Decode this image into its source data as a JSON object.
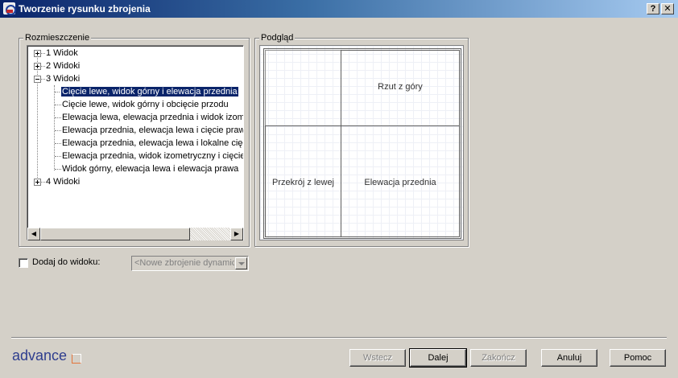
{
  "window": {
    "title": "Tworzenie rysunku zbrojenia",
    "help_button": "?",
    "close_button": "✕"
  },
  "layout_group": {
    "label": "Rozmieszczenie",
    "tree": {
      "nodes": [
        {
          "label": "1 Widok",
          "expanded": false
        },
        {
          "label": "2 Widoki",
          "expanded": false
        },
        {
          "label": "3 Widoki",
          "expanded": true
        },
        {
          "label": "4 Widoki",
          "expanded": false
        }
      ],
      "children": [
        "Cięcie lewe, widok górny i elewacja przednia",
        "Cięcie lewe, widok górny i obcięcie przodu",
        "Elewacja lewa, elewacja przednia i widok izometryczny",
        "Elewacja przednia, elewacja lewa i cięcie prawe",
        "Elewacja przednia, elewacja lewa i lokalne cięcie",
        "Elewacja przednia, widok izometryczny i cięcie lewe",
        "Widok górny, elewacja lewa i elewacja prawa"
      ],
      "selected_child": 0
    }
  },
  "preview_group": {
    "label": "Podgląd",
    "views": {
      "top": "Rzut z góry",
      "left": "Przekrój z lewej",
      "front": "Elewacja przednia"
    }
  },
  "add_to_view": {
    "label": "Dodaj do widoku:",
    "checked": false,
    "combo_value": "<Nowe zbrojenie dynamiczne>"
  },
  "logo": "advance",
  "buttons": {
    "back": "Wstecz",
    "next": "Dalej",
    "finish": "Zakończ",
    "cancel": "Anuluj",
    "help": "Pomoc"
  },
  "colors": {
    "title_bar": "#0a246a",
    "selection": "#0a246a",
    "logo": "#2e3d8e",
    "logo_accent": "#e4743a"
  }
}
